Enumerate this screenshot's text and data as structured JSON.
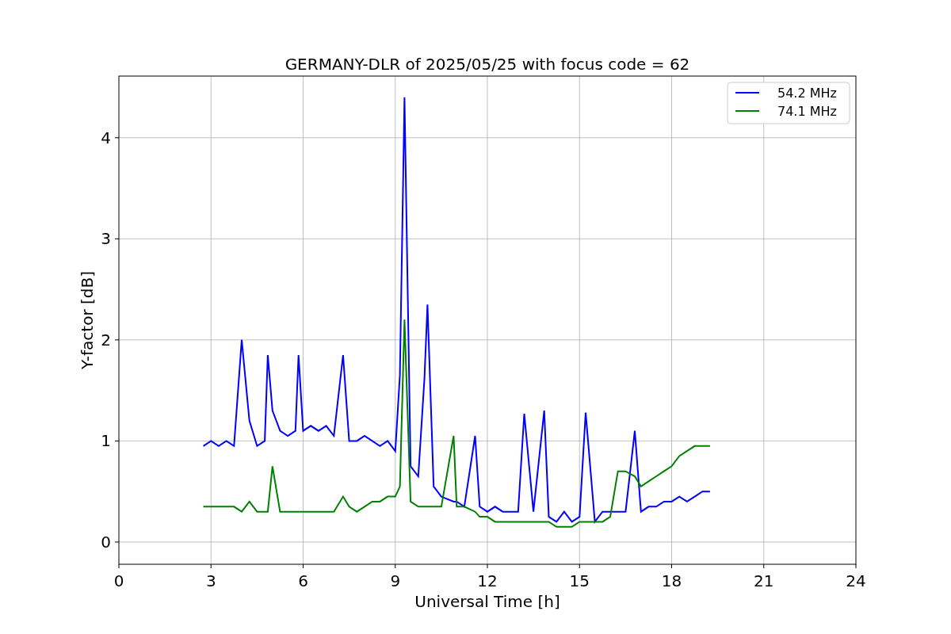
{
  "chart_data": {
    "type": "line",
    "title": "GERMANY-DLR of 2025/05/25 with focus code = 62",
    "xlabel": "Universal Time [h]",
    "ylabel": "Y-factor [dB]",
    "xlim": [
      0,
      24
    ],
    "ylim": [
      -0.22,
      4.61
    ],
    "xticks": [
      0,
      3,
      6,
      9,
      12,
      15,
      18,
      21,
      24
    ],
    "yticks": [
      0,
      1,
      2,
      3,
      4
    ],
    "grid": true,
    "legend": true,
    "x": [
      2.75,
      3,
      3.25,
      3.5,
      3.75,
      4,
      4.25,
      4.5,
      4.75,
      4.85,
      5,
      5.25,
      5.5,
      5.75,
      5.85,
      6,
      6.25,
      6.5,
      6.75,
      7,
      7.3,
      7.5,
      7.75,
      8,
      8.25,
      8.5,
      8.75,
      9,
      9.15,
      9.3,
      9.5,
      9.75,
      9.95,
      10.05,
      10.25,
      10.5,
      10.9,
      11,
      11.25,
      11.6,
      11.75,
      12,
      12.25,
      12.5,
      12.75,
      13,
      13.2,
      13.5,
      13.85,
      14,
      14.25,
      14.5,
      14.75,
      15,
      15.2,
      15.5,
      15.75,
      16,
      16.25,
      16.5,
      16.8,
      17,
      17.25,
      17.5,
      17.75,
      18,
      18.25,
      18.5,
      18.75,
      19,
      19.25
    ],
    "series": [
      {
        "name": "54.2 MHz",
        "color": "#0000ff",
        "values": [
          0.95,
          1.0,
          0.95,
          1.0,
          0.95,
          2.0,
          1.2,
          0.95,
          1.0,
          1.85,
          1.3,
          1.1,
          1.05,
          1.1,
          1.85,
          1.1,
          1.15,
          1.1,
          1.15,
          1.05,
          1.85,
          1.0,
          1.0,
          1.05,
          1.0,
          0.95,
          1.0,
          0.9,
          1.65,
          4.4,
          0.75,
          0.65,
          1.62,
          2.35,
          0.55,
          0.45,
          0.4,
          0.4,
          0.35,
          1.05,
          0.35,
          0.3,
          0.35,
          0.3,
          0.3,
          0.3,
          1.27,
          0.3,
          1.3,
          0.25,
          0.2,
          0.3,
          0.2,
          0.25,
          1.28,
          0.2,
          0.3,
          0.3,
          0.3,
          0.3,
          1.1,
          0.3,
          0.35,
          0.35,
          0.4,
          0.4,
          0.45,
          0.4,
          0.45,
          0.5,
          0.5
        ]
      },
      {
        "name": "74.1 MHz",
        "color": "#008000",
        "values": [
          0.35,
          0.35,
          0.35,
          0.35,
          0.35,
          0.3,
          0.4,
          0.3,
          0.3,
          0.3,
          0.75,
          0.3,
          0.3,
          0.3,
          0.3,
          0.3,
          0.3,
          0.3,
          0.3,
          0.3,
          0.45,
          0.35,
          0.3,
          0.35,
          0.4,
          0.4,
          0.45,
          0.45,
          0.55,
          2.2,
          0.4,
          0.35,
          0.35,
          0.35,
          0.35,
          0.35,
          1.05,
          0.35,
          0.35,
          0.3,
          0.25,
          0.25,
          0.2,
          0.2,
          0.2,
          0.2,
          0.2,
          0.2,
          0.2,
          0.2,
          0.15,
          0.15,
          0.15,
          0.2,
          0.2,
          0.2,
          0.2,
          0.25,
          0.7,
          0.7,
          0.65,
          0.55,
          0.6,
          0.65,
          0.7,
          0.75,
          0.85,
          0.9,
          0.95,
          0.95,
          0.95
        ]
      }
    ]
  }
}
